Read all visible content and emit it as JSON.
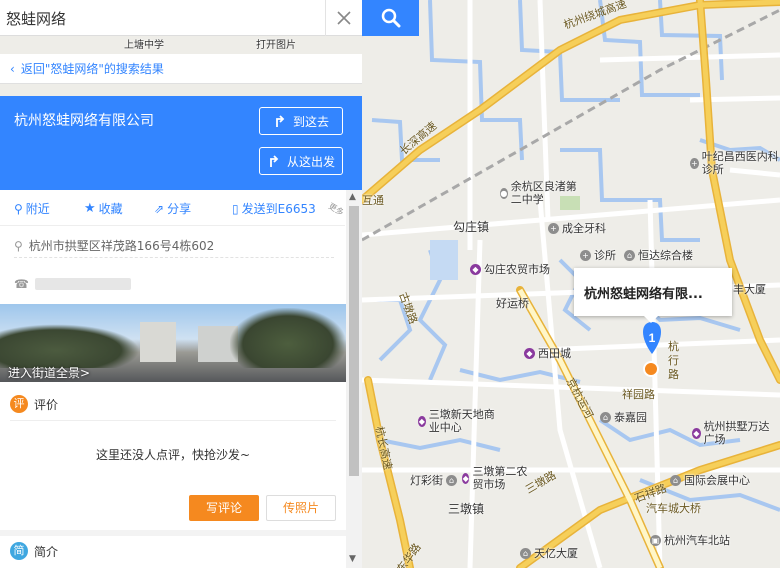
{
  "search": {
    "value": "怒蛙网络",
    "clear_icon": "close-icon",
    "search_icon": "search-icon"
  },
  "back_link": {
    "label": "返回\"怒蛙网络\"的搜索结果"
  },
  "place": {
    "name": "杭州怒蛙网络有限公司",
    "to_here": "到这去",
    "from_here": "从这出发",
    "address": "杭州市拱墅区祥茂路166号4栋602",
    "phone": ""
  },
  "actions": {
    "nearby": "附近",
    "favorite": "收藏",
    "share": "分享",
    "send": "发送到E6653",
    "more": "更多"
  },
  "street_view": {
    "label": "进入街道全景>"
  },
  "reviews": {
    "badge": "评",
    "title": "评价",
    "empty": "这里还没人点评，快抢沙发~",
    "write": "写评论",
    "upload": "传照片"
  },
  "intro": {
    "badge": "简",
    "title": "简介"
  },
  "colors": {
    "accent": "#3385ff",
    "orange": "#f5891f",
    "highway": "#f6cf5a",
    "water": "#a8c7f0"
  },
  "map": {
    "popup": "杭州怒蛙网络有限...",
    "marker_number": "1",
    "road_labels": [
      "杭州绕城高速",
      "长深高速",
      "古墩路",
      "京杭运河",
      "杭长高速",
      "三墩路",
      "石祥路",
      "祥园路",
      "杭行路",
      "东华路"
    ],
    "pois": [
      {
        "label": "余杭区良渚第二中学",
        "kind": "school"
      },
      {
        "label": "成全牙科"
      },
      {
        "label": "诊所"
      },
      {
        "label": "恒达综合楼"
      },
      {
        "label": "勾庄农贸市场",
        "kind": "market"
      },
      {
        "label": "西田城",
        "kind": "market"
      },
      {
        "label": "三墩新天地商业中心",
        "kind": "market"
      },
      {
        "label": "泰嘉园"
      },
      {
        "label": "杭州拱墅万达广场",
        "kind": "market"
      },
      {
        "label": "三墩第二农贸市场",
        "kind": "market"
      },
      {
        "label": "灯彩街"
      },
      {
        "label": "国际会展中心"
      },
      {
        "label": "天亿大厦"
      },
      {
        "label": "杭州汽车北站"
      },
      {
        "label": "叶纪昌西医内科诊所"
      },
      {
        "label": "上塘中学"
      },
      {
        "label": "打开图片"
      }
    ],
    "place_labels": [
      "勾庄镇",
      "好运桥",
      "三墩镇",
      "汽车城大桥",
      "丰大厦",
      "互通",
      "良渚路"
    ]
  }
}
